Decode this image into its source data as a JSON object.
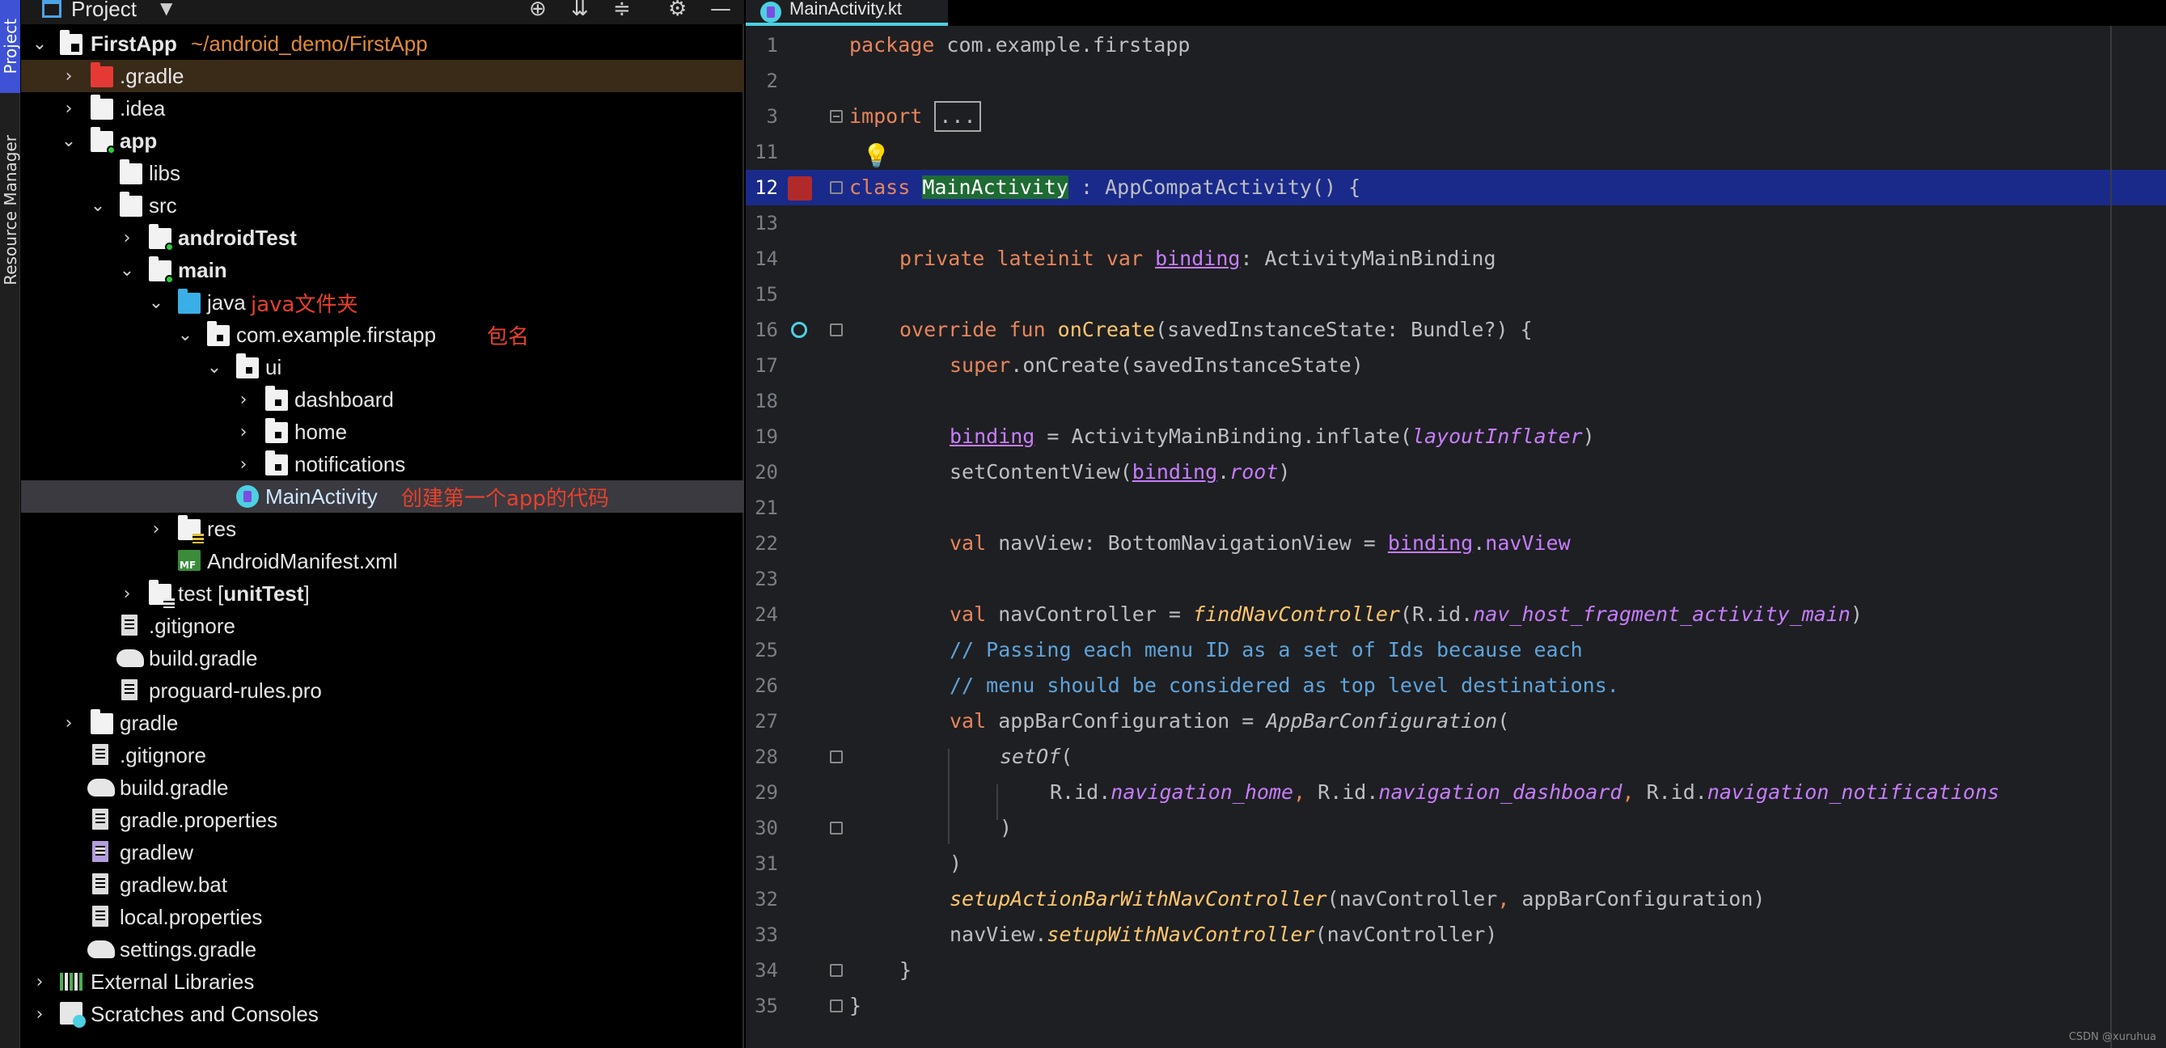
{
  "tool_stripe": {
    "project": "Project",
    "resource_manager": "Resource Manager"
  },
  "project_panel": {
    "title": "Project",
    "tools": [
      "target-icon",
      "expand-all-icon",
      "collapse-all-icon",
      "gear-icon",
      "minimize-icon"
    ],
    "tree": [
      {
        "label": "FirstApp",
        "path": "~/android_demo/FirstApp",
        "bold": true,
        "arrow": "v"
      },
      {
        "label": ".gradle",
        "arrow": ">"
      },
      {
        "label": ".idea",
        "arrow": ">"
      },
      {
        "label": "app",
        "bold": true,
        "arrow": "v"
      },
      {
        "label": "libs",
        "arrow": ""
      },
      {
        "label": "src",
        "arrow": "v"
      },
      {
        "label": "androidTest",
        "bold": true,
        "arrow": ">"
      },
      {
        "label": "main",
        "bold": true,
        "arrow": "v"
      },
      {
        "label": "java",
        "arrow": "v",
        "note": "java文件夹"
      },
      {
        "label": "com.example.firstapp",
        "arrow": "v",
        "note": "包名"
      },
      {
        "label": "ui",
        "arrow": "v"
      },
      {
        "label": "dashboard",
        "arrow": ">"
      },
      {
        "label": "home",
        "arrow": ">"
      },
      {
        "label": "notifications",
        "arrow": ">"
      },
      {
        "label": "MainActivity",
        "arrow": "",
        "note": "创建第一个app的代码"
      },
      {
        "label": "res",
        "arrow": ">"
      },
      {
        "label": "AndroidManifest.xml",
        "arrow": ""
      },
      {
        "label": "test [",
        "label_bold": "unitTest",
        "label_end": "]",
        "arrow": ">"
      },
      {
        "label": ".gitignore",
        "arrow": ""
      },
      {
        "label": "build.gradle",
        "arrow": ""
      },
      {
        "label": "proguard-rules.pro",
        "arrow": ""
      },
      {
        "label": "gradle",
        "arrow": ">"
      },
      {
        "label": ".gitignore",
        "arrow": ""
      },
      {
        "label": "build.gradle",
        "arrow": ""
      },
      {
        "label": "gradle.properties",
        "arrow": ""
      },
      {
        "label": "gradlew",
        "arrow": ""
      },
      {
        "label": "gradlew.bat",
        "arrow": ""
      },
      {
        "label": "local.properties",
        "arrow": ""
      },
      {
        "label": "settings.gradle",
        "arrow": ""
      },
      {
        "label": "External Libraries",
        "arrow": ">"
      },
      {
        "label": "Scratches and Consoles",
        "arrow": ">"
      }
    ]
  },
  "editor": {
    "tab": "MainActivity.kt",
    "line_numbers": [
      "1",
      "2",
      "3",
      "11",
      "12",
      "13",
      "14",
      "15",
      "16",
      "17",
      "18",
      "19",
      "20",
      "21",
      "22",
      "23",
      "24",
      "25",
      "26",
      "27",
      "28",
      "29",
      "30",
      "31",
      "32",
      "33",
      "34",
      "35"
    ],
    "code": {
      "l1_kw": "package",
      "l1_rest": " com.example.firstapp",
      "l3_kw": "import",
      "l3_dots": "...",
      "l12_kw": "class",
      "l12_name": "MainActivity",
      "l12_rest": " : AppCompatActivity() {",
      "l14_kw": "private lateinit var ",
      "l14_prop": "binding",
      "l14_rest": ": ActivityMainBinding",
      "l16_kw": "override fun ",
      "l16_fn": "onCreate",
      "l16_rest": "(savedInstanceState: Bundle?) {",
      "l17_kw": "super",
      "l17_rest": ".onCreate(savedInstanceState)",
      "l19_prop": "binding",
      "l19_mid": " = ActivityMainBinding.inflate(",
      "l19_it": "layoutInflater",
      "l19_end": ")",
      "l20_a": "setContentView(",
      "l20_prop": "binding",
      "l20_dot": ".",
      "l20_it": "root",
      "l20_end": ")",
      "l22_kw": "val ",
      "l22_mid": "navView: BottomNavigationView = ",
      "l22_prop": "binding",
      "l22_dot": ".",
      "l22_p2": "navView",
      "l24_kw": "val ",
      "l24_mid": "navController = ",
      "l24_fn": "findNavController",
      "l24_a": "(R.id.",
      "l24_it": "nav_host_fragment_activity_main",
      "l24_end": ")",
      "l25": "// Passing each menu ID as a set of Ids because each",
      "l26": "// menu should be considered as top level destinations.",
      "l27_kw": "val ",
      "l27_mid": "appBarConfiguration = ",
      "l27_it": "AppBarConfiguration",
      "l27_end": "(",
      "l28_fn": "setOf",
      "l28_end": "(",
      "l29_a": "R.id.",
      "l29_p1": "navigation_home",
      "l29_c1": ", ",
      "l29_b": "R.id.",
      "l29_p2": "navigation_dashboard",
      "l29_c2": ", ",
      "l29_c": "R.id.",
      "l29_p3": "navigation_notifications",
      "l30": ")",
      "l31": ")",
      "l32_fn": "setupActionBarWithNavController",
      "l32_a": "(navController",
      "l32_c": ", ",
      "l32_b": "appBarConfiguration)",
      "l33_a": "navView.",
      "l33_fn": "setupWithNavController",
      "l33_b": "(navController)",
      "l34": "}",
      "l35": "}"
    }
  },
  "watermark": "CSDN @xuruhua",
  "colors": {
    "keyword": "#e7855c",
    "function": "#ffc66d",
    "property": "#c77dff",
    "comment": "#5fa4dc",
    "annotation": "#e8402c",
    "selection": "#1a2a8a"
  }
}
